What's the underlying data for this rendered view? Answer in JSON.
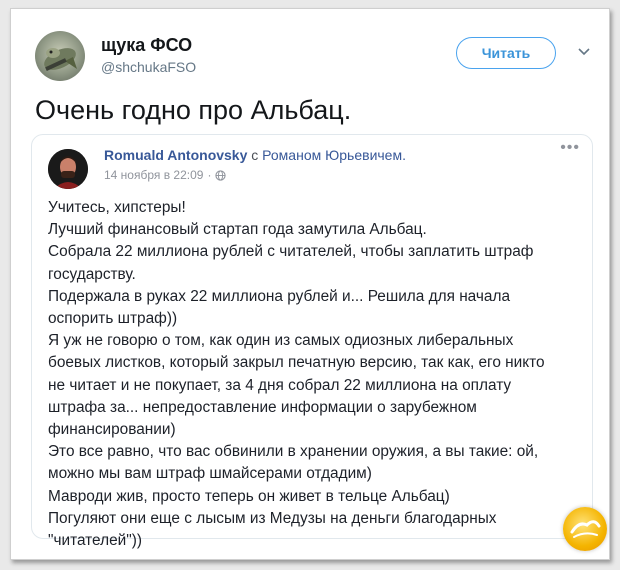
{
  "tweet": {
    "author_name": "щука ФСО",
    "author_handle": "@shchukaFSO",
    "follow_label": "Читать",
    "text": "Очень годно про Альбац."
  },
  "embed": {
    "author": "Romuald Antonovsky",
    "with_word": "с",
    "with_name": "Романом Юрьевичем.",
    "time": "14 ноября в 22:09",
    "body_lines": [
      "Учитесь, хипстеры!",
      "Лучший финансовый стартап года замутила Альбац.",
      "Собрала 22 миллиона рублей с читателей, чтобы заплатить штраф",
      "государству.",
      "Подержала в руках 22 миллиона рублей и... Решила для начала",
      "оспорить штраф))",
      "Я уж не говорю о том, как один из самых одиозных либеральных",
      "боевых листков, который закрыл печатную версию, так как, его никто",
      "не читает и не покупает, за 4 дня собрал 22 миллиона на оплату",
      "штрафа за... непредоставление информации о зарубежном",
      "финансировании)",
      "Это все равно, что вас обвинили в хранении оружия, а вы такие: ой,",
      "можно мы вам штраф шмайсерами отдадим)",
      "Мавроди жив, просто теперь он живет в тельце Альбац)",
      "Погуляют они еще с лысым из Медузы на деньги благодарных",
      "\"читателей\"))"
    ]
  },
  "icons": {
    "more": "more-icon",
    "chevron": "chevron-down-icon",
    "privacy": "globe-icon"
  },
  "colors": {
    "accent": "#3b94d9",
    "fb_link": "#385898"
  }
}
